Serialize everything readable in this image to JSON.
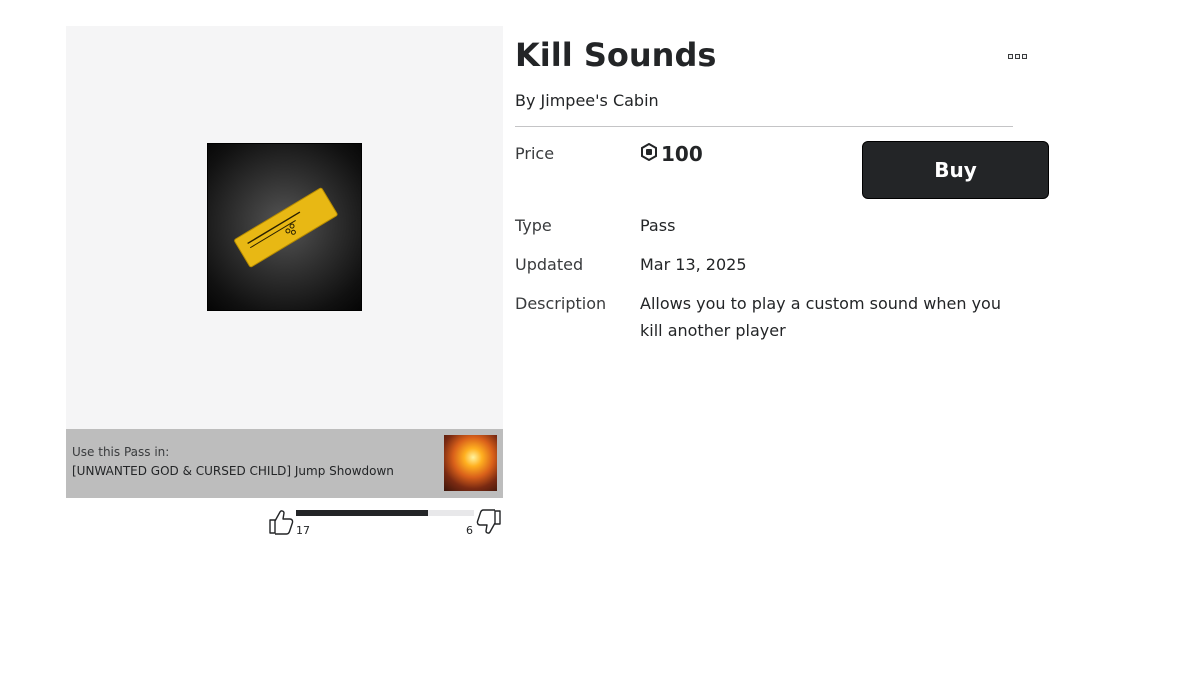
{
  "item": {
    "title": "Kill Sounds",
    "creator": "By Jimpee's Cabin"
  },
  "details": {
    "price_label": "Price",
    "price_value": "100",
    "type_label": "Type",
    "type_value": "Pass",
    "updated_label": "Updated",
    "updated_value": "Mar 13, 2025",
    "description_label": "Description",
    "description_value": "Allows you to play a custom sound when you kill another player"
  },
  "buy_button": {
    "label": "Buy"
  },
  "use_in": {
    "label": "Use this Pass in:",
    "game_name": "[UNWANTED GOD & CURSED CHILD] Jump Showdown"
  },
  "votes": {
    "up_count": "17",
    "down_count": "6",
    "up_fraction": 0.74
  },
  "colors": {
    "pass_badge": "#e8b814",
    "dark": "#232527"
  },
  "icons": {
    "more": "more-options-icon",
    "robux": "robux-icon",
    "thumb_up": "thumbs-up-icon",
    "thumb_down": "thumbs-down-icon"
  }
}
